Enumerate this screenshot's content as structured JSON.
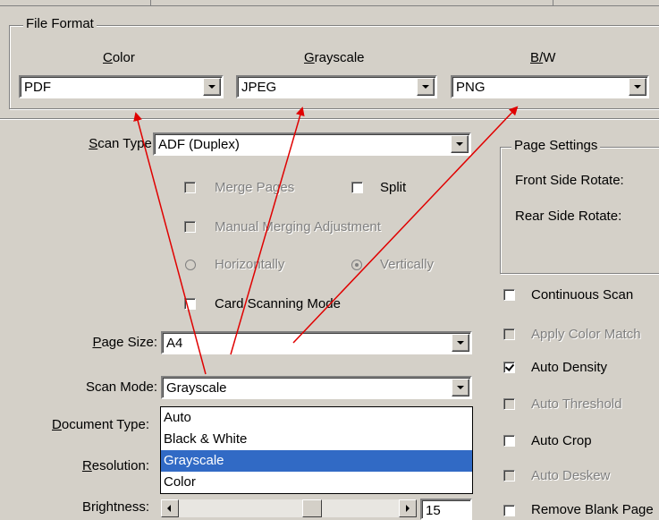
{
  "file_format": {
    "legend": "File Format",
    "color_label": "Color",
    "grayscale_label": "Grayscale",
    "bw_label": "B/W",
    "color_value": "PDF",
    "grayscale_value": "JPEG",
    "bw_value": "PNG"
  },
  "scan": {
    "scan_type_label": "Scan Type:",
    "scan_type_value": "ADF (Duplex)",
    "merge_pages": "Merge Pages",
    "split": "Split",
    "manual_merging": "Manual Merging Adjustment",
    "horizontally": "Horizontally",
    "vertically": "Vertically",
    "card_scanning": "Card Scanning Mode",
    "page_size_label": "Page Size:",
    "page_size_value": "A4",
    "scan_mode_label": "Scan Mode:",
    "scan_mode_value": "Grayscale",
    "document_type_label": "Document Type:",
    "resolution_label": "Resolution:",
    "brightness_label": "Brightness:",
    "brightness_value": "15"
  },
  "scan_mode_options": [
    "Auto",
    "Black & White",
    "Grayscale",
    "Color"
  ],
  "scan_mode_selected": "Grayscale",
  "page_settings": {
    "legend": "Page Settings",
    "front_rotate": "Front Side Rotate:",
    "rear_rotate": "Rear Side Rotate:"
  },
  "options": {
    "continuous_scan": "Continuous Scan",
    "apply_color_match": "Apply Color Match",
    "auto_density": "Auto Density",
    "auto_threshold": "Auto Threshold",
    "auto_crop": "Auto Crop",
    "auto_deskew": "Auto Deskew",
    "remove_blank": "Remove Blank Page"
  },
  "colors": {
    "dialog_bg": "#d4d0c8",
    "selection": "#316ac5",
    "annotation_arrow": "#e00000"
  }
}
